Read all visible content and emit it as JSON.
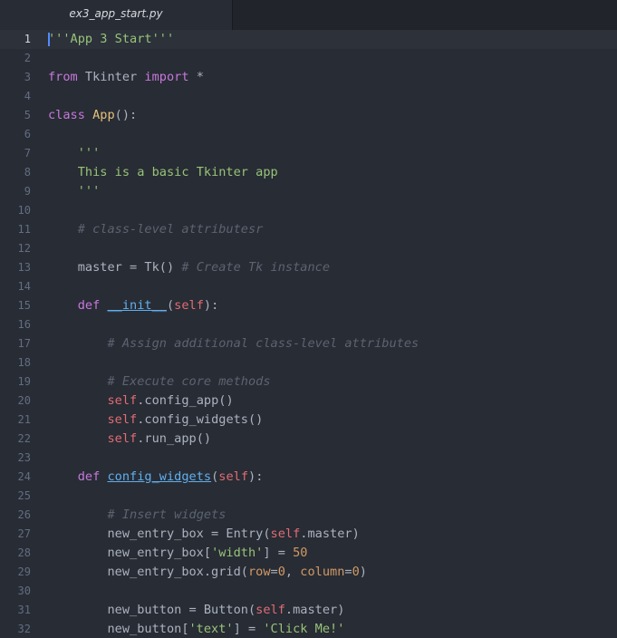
{
  "tab": {
    "title": "ex3_app_start.py"
  },
  "editor": {
    "active_line": 1,
    "lines": [
      [
        {
          "t": "'''App 3 Start'''",
          "c": "str"
        }
      ],
      [],
      [
        {
          "t": "from",
          "c": "kw"
        },
        {
          "t": " Tkinter "
        },
        {
          "t": "import",
          "c": "kw"
        },
        {
          "t": " *"
        }
      ],
      [],
      [
        {
          "t": "class",
          "c": "kw"
        },
        {
          "t": " "
        },
        {
          "t": "App",
          "c": "cls"
        },
        {
          "t": "():"
        }
      ],
      [],
      [
        {
          "t": "    "
        },
        {
          "t": "'''",
          "c": "str"
        }
      ],
      [
        {
          "t": "    "
        },
        {
          "t": "This is a basic Tkinter app",
          "c": "str"
        }
      ],
      [
        {
          "t": "    "
        },
        {
          "t": "'''",
          "c": "str"
        }
      ],
      [],
      [
        {
          "t": "    "
        },
        {
          "t": "# class-level attributesr",
          "c": "cmt"
        }
      ],
      [],
      [
        {
          "t": "    master = Tk() "
        },
        {
          "t": "# Create Tk instance",
          "c": "cmt"
        }
      ],
      [],
      [
        {
          "t": "    "
        },
        {
          "t": "def",
          "c": "kw"
        },
        {
          "t": " "
        },
        {
          "t": "__init__",
          "c": "fn"
        },
        {
          "t": "("
        },
        {
          "t": "self",
          "c": "slf"
        },
        {
          "t": "):"
        }
      ],
      [],
      [
        {
          "t": "        "
        },
        {
          "t": "# Assign additional class-level attributes",
          "c": "cmt"
        }
      ],
      [],
      [
        {
          "t": "        "
        },
        {
          "t": "# Execute core methods",
          "c": "cmt"
        }
      ],
      [
        {
          "t": "        "
        },
        {
          "t": "self",
          "c": "slf"
        },
        {
          "t": ".config_app()"
        }
      ],
      [
        {
          "t": "        "
        },
        {
          "t": "self",
          "c": "slf"
        },
        {
          "t": ".config_widgets()"
        }
      ],
      [
        {
          "t": "        "
        },
        {
          "t": "self",
          "c": "slf"
        },
        {
          "t": ".run_app()"
        }
      ],
      [],
      [
        {
          "t": "    "
        },
        {
          "t": "def",
          "c": "kw"
        },
        {
          "t": " "
        },
        {
          "t": "config_widgets",
          "c": "fn"
        },
        {
          "t": "("
        },
        {
          "t": "self",
          "c": "slf"
        },
        {
          "t": "):"
        }
      ],
      [],
      [
        {
          "t": "        "
        },
        {
          "t": "# Insert widgets",
          "c": "cmt"
        }
      ],
      [
        {
          "t": "        new_entry_box = Entry("
        },
        {
          "t": "self",
          "c": "slf"
        },
        {
          "t": ".master)"
        }
      ],
      [
        {
          "t": "        new_entry_box["
        },
        {
          "t": "'width'",
          "c": "str"
        },
        {
          "t": "] = "
        },
        {
          "t": "50",
          "c": "num"
        }
      ],
      [
        {
          "t": "        new_entry_box.grid("
        },
        {
          "t": "row",
          "c": "prm"
        },
        {
          "t": "="
        },
        {
          "t": "0",
          "c": "num"
        },
        {
          "t": ", "
        },
        {
          "t": "column",
          "c": "prm"
        },
        {
          "t": "="
        },
        {
          "t": "0",
          "c": "num"
        },
        {
          "t": ")"
        }
      ],
      [],
      [
        {
          "t": "        new_button = Button("
        },
        {
          "t": "self",
          "c": "slf"
        },
        {
          "t": ".master)"
        }
      ],
      [
        {
          "t": "        new_button["
        },
        {
          "t": "'text'",
          "c": "str"
        },
        {
          "t": "] = "
        },
        {
          "t": "'Click Me!'",
          "c": "str"
        }
      ]
    ]
  }
}
